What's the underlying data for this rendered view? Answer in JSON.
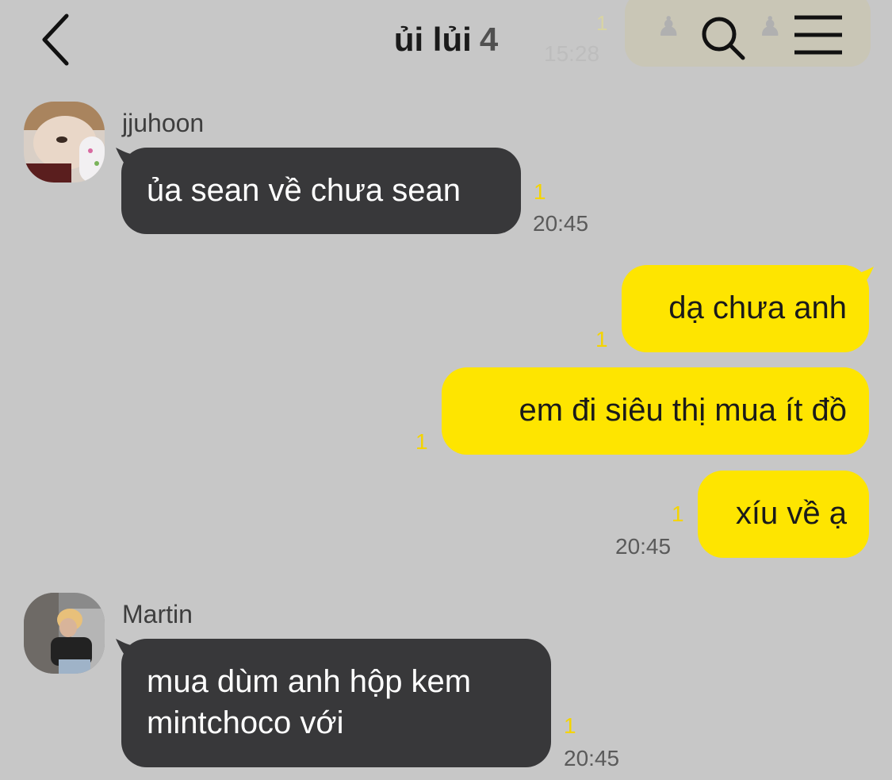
{
  "header": {
    "title": "ủi lủi",
    "member_count": "4",
    "back_icon": "chevron-left-icon",
    "search_icon": "search-icon",
    "menu_icon": "menu-icon",
    "overlap_time": "15:28",
    "overlap_unread": "1"
  },
  "messages": [
    {
      "sender": "jjuhoon",
      "direction": "incoming",
      "text": "ủa sean về chưa sean",
      "unread": "1",
      "time": "20:45"
    },
    {
      "direction": "outgoing",
      "text": "dạ chưa anh",
      "unread": "1"
    },
    {
      "direction": "outgoing",
      "text": "em đi siêu thị mua ít đồ",
      "unread": "1"
    },
    {
      "direction": "outgoing",
      "text": "xíu về ạ",
      "unread": "1",
      "time": "20:45"
    },
    {
      "sender": "Martin",
      "direction": "incoming",
      "text_lines": [
        "mua dùm anh hộp kem",
        "mintchoco với"
      ],
      "unread": "1",
      "time": "20:45"
    }
  ],
  "colors": {
    "background": "#c7c7c7",
    "incoming_bubble": "#38383a",
    "outgoing_bubble": "#fee500",
    "unread_count": "#f4d400"
  }
}
